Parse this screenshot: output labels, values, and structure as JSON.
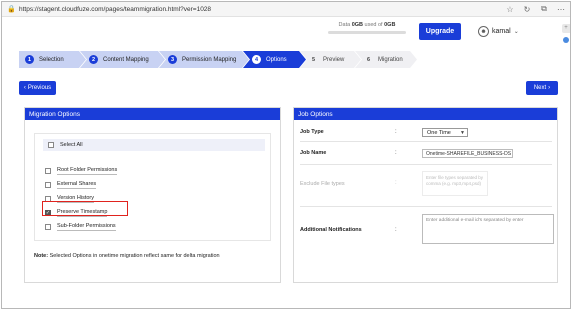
{
  "browser": {
    "url": "https://stagent.cloudfuze.com/pages/teammigration.html?ver=1028"
  },
  "header": {
    "data_prefix": "Data",
    "data_used": "0GB",
    "data_mid": "used of",
    "data_total": "0GB",
    "upgrade_label": "Upgrade",
    "user_name": "kamal"
  },
  "steps": [
    {
      "num": "1",
      "label": "Selection",
      "state": "done"
    },
    {
      "num": "2",
      "label": "Content Mapping",
      "state": "done"
    },
    {
      "num": "3",
      "label": "Permission Mapping",
      "state": "done"
    },
    {
      "num": "4",
      "label": "Options",
      "state": "active"
    },
    {
      "num": "5",
      "label": "Preview",
      "state": "todo"
    },
    {
      "num": "6",
      "label": "Migration",
      "state": "todo"
    }
  ],
  "nav": {
    "previous_label": "Previous",
    "next_label": "Next"
  },
  "migration_options": {
    "title": "Migration Options",
    "select_all": "Select All",
    "options": [
      {
        "label": "Root Folder Permissions",
        "checked": false
      },
      {
        "label": "External Shares",
        "checked": false
      },
      {
        "label": "Version History",
        "checked": false
      },
      {
        "label": "Preserve Timestamp",
        "checked": true
      },
      {
        "label": "Sub-Folder Permissions",
        "checked": false
      }
    ],
    "note_bold": "Note:",
    "note_text": " Selected Options in onetime migration reflect same for delta migration"
  },
  "job_options": {
    "title": "Job Options",
    "job_type_label": "Job Type",
    "job_type_value": "One Time",
    "job_name_label": "Job Name",
    "job_name_value": "Onetime-SHAREFILE_BUSINESS-DS",
    "exclude_label": "Exclude File types",
    "exclude_placeholder": "Enter file types separated by comma (e.g. mp3,mp4,psd)",
    "notifications_label": "Additional Notifications",
    "notifications_placeholder": "Enter additional e-mail id's separated by enter",
    "colon": ":"
  },
  "colors": {
    "accent": "#1a3dd8",
    "step_done": "#c8d2f3",
    "highlight": "#e0231e"
  },
  "icons": [
    "lock-icon",
    "star-icon",
    "refresh-icon",
    "extensions-icon",
    "more-icon",
    "user-icon",
    "chevron-down-icon",
    "chevron-left-icon",
    "chevron-right-icon",
    "checkbox-icon",
    "check-icon"
  ]
}
